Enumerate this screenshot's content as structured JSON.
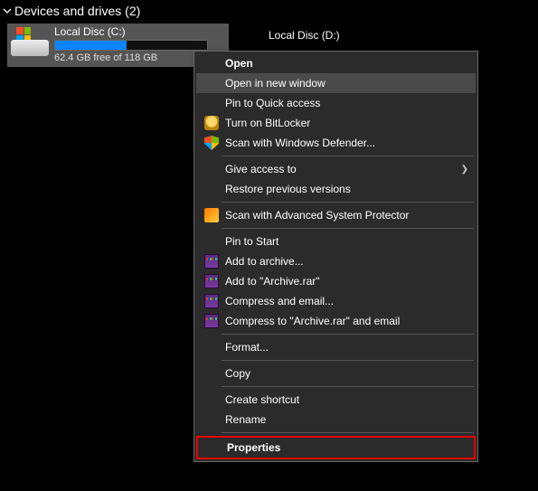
{
  "header": {
    "title": "Devices and drives (2)"
  },
  "drives": {
    "c": {
      "label": "Local Disc (C:)",
      "subtext": "62.4 GB free of 118 GB",
      "used_percent": 47
    },
    "d": {
      "label": "Local Disc (D:)"
    }
  },
  "context_menu": {
    "open": "Open",
    "open_new_window": "Open in new window",
    "pin_quick_access": "Pin to Quick access",
    "bitlocker": "Turn on BitLocker",
    "defender": "Scan with Windows Defender...",
    "give_access": "Give access to",
    "restore": "Restore previous versions",
    "asp_scan": "Scan with Advanced System Protector",
    "pin_start": "Pin to Start",
    "add_archive": "Add to archive...",
    "add_archive_rar": "Add to \"Archive.rar\"",
    "compress_email": "Compress and email...",
    "compress_archive_email": "Compress to \"Archive.rar\" and email",
    "format": "Format...",
    "copy": "Copy",
    "create_shortcut": "Create shortcut",
    "rename": "Rename",
    "properties": "Properties"
  }
}
